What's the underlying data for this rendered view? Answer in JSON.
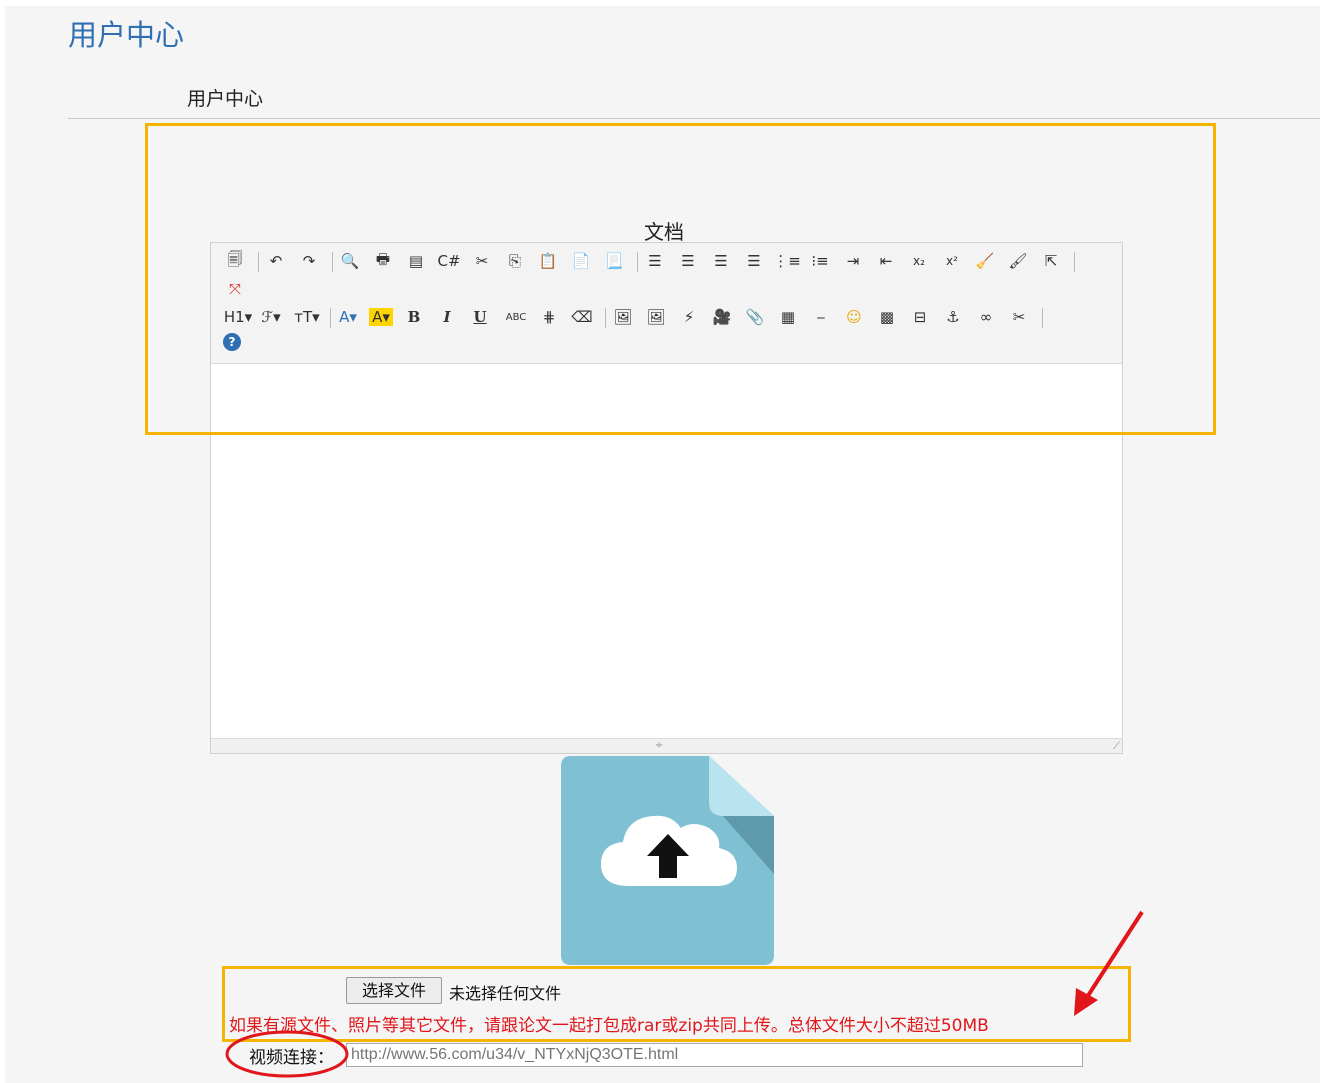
{
  "header": {
    "title": "用户中心",
    "subtitle": "用户中心"
  },
  "editor": {
    "label": "文档",
    "toolbar_row1": [
      {
        "icon": "source-icon",
        "glyph": "🗐"
      },
      {
        "sep": true
      },
      {
        "icon": "undo-icon",
        "glyph": "↶"
      },
      {
        "icon": "redo-icon",
        "glyph": "↷"
      },
      {
        "sep": true
      },
      {
        "icon": "preview-icon",
        "glyph": "🔍"
      },
      {
        "icon": "print-icon",
        "glyph": "🖶"
      },
      {
        "icon": "template-icon",
        "glyph": "▤"
      },
      {
        "icon": "code-icon",
        "glyph": "C#"
      },
      {
        "icon": "cut-icon",
        "glyph": "✂"
      },
      {
        "icon": "copy-icon",
        "glyph": "⎘"
      },
      {
        "icon": "paste-icon",
        "glyph": "📋"
      },
      {
        "icon": "paste-text-icon",
        "glyph": "📄"
      },
      {
        "icon": "paste-word-icon",
        "glyph": "📃"
      },
      {
        "sep": true
      },
      {
        "icon": "align-left-icon",
        "glyph": "☰"
      },
      {
        "icon": "align-center-icon",
        "glyph": "☰"
      },
      {
        "icon": "align-right-icon",
        "glyph": "☰"
      },
      {
        "icon": "align-justify-icon",
        "glyph": "☰"
      },
      {
        "icon": "ordered-list-icon",
        "glyph": "⋮≡"
      },
      {
        "icon": "unordered-list-icon",
        "glyph": "⁝≡"
      },
      {
        "icon": "indent-icon",
        "glyph": "⇥"
      },
      {
        "icon": "outdent-icon",
        "glyph": "⇤"
      },
      {
        "icon": "subscript-icon",
        "glyph": "x₂"
      },
      {
        "icon": "superscript-icon",
        "glyph": "x²"
      },
      {
        "icon": "clear-format-icon",
        "glyph": "🧹"
      },
      {
        "icon": "format-brush-icon",
        "glyph": "🖌"
      },
      {
        "icon": "select-all-icon",
        "glyph": "⇱"
      },
      {
        "sep": true
      }
    ],
    "toolbar_row2": [
      {
        "icon": "fullscreen-icon",
        "glyph": "⤧"
      }
    ],
    "toolbar_row3": [
      {
        "icon": "heading-icon",
        "glyph": "H1▾"
      },
      {
        "icon": "font-family-icon",
        "glyph": "ℱ▾"
      },
      {
        "icon": "font-size-icon",
        "glyph": "тT▾"
      },
      {
        "sep": true
      },
      {
        "icon": "font-color-icon",
        "glyph": "A▾"
      },
      {
        "icon": "highlight-icon",
        "glyph": "A▾"
      },
      {
        "icon": "bold-icon",
        "glyph": "B"
      },
      {
        "icon": "italic-icon",
        "glyph": "I"
      },
      {
        "icon": "underline-icon",
        "glyph": "U"
      },
      {
        "icon": "strikethrough-icon",
        "glyph": "ABC"
      },
      {
        "icon": "line-height-icon",
        "glyph": "⋕"
      },
      {
        "icon": "eraser-icon",
        "glyph": "⌫"
      },
      {
        "sep": true
      },
      {
        "icon": "insert-image-icon",
        "glyph": "🖼"
      },
      {
        "icon": "multi-image-icon",
        "glyph": "🖼"
      },
      {
        "icon": "flash-icon",
        "glyph": "⚡"
      },
      {
        "icon": "media-icon",
        "glyph": "🎥"
      },
      {
        "icon": "attachment-icon",
        "glyph": "📎"
      },
      {
        "icon": "table-icon",
        "glyph": "▦"
      },
      {
        "icon": "horizontal-rule-icon",
        "glyph": "⎯"
      },
      {
        "icon": "emoticon-icon",
        "glyph": "☺"
      },
      {
        "icon": "map-icon",
        "glyph": "▩"
      },
      {
        "icon": "page-break-icon",
        "glyph": "⊟"
      },
      {
        "icon": "anchor-icon",
        "glyph": "⚓"
      },
      {
        "icon": "link-icon",
        "glyph": "∞"
      },
      {
        "icon": "unlink-icon",
        "glyph": "✂"
      },
      {
        "sep": true
      }
    ],
    "toolbar_row4": [
      {
        "icon": "help-icon",
        "glyph": "?"
      }
    ]
  },
  "upload": {
    "icon": "cloud-upload-icon",
    "choose_button": "选择文件",
    "no_file_text": "未选择任何文件",
    "note": "如果有源文件、照片等其它文件，请跟论文一起打包成rar或zip共同上传。总体文件大小不超过50MB"
  },
  "video": {
    "label": "视频连接：",
    "placeholder": "http://www.56.com/u34/v_NTYxNjQ3OTE.html"
  },
  "colors": {
    "title": "#2f6fb4",
    "highlight_box": "#f6b400",
    "note_text": "#e0161b",
    "annotation": "#e0161b",
    "upload_icon_bg": "#7fc0d2"
  }
}
